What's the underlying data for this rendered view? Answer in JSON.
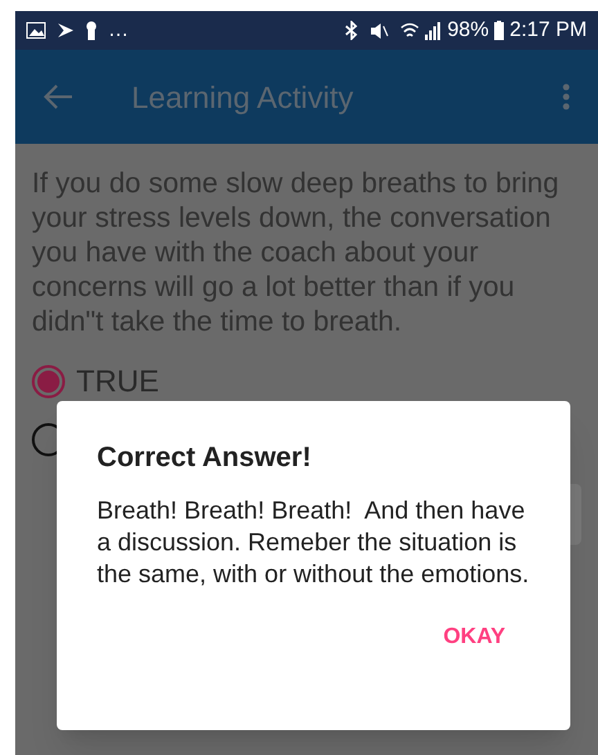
{
  "status_bar": {
    "overflow": "…",
    "battery": "98%",
    "time": "2:17 PM"
  },
  "app_bar": {
    "title": "Learning Activity"
  },
  "question": "If you do some slow deep breaths to bring your stress levels down, the conversation you have with the coach about your concerns will go a lot better than if you didn\"t take the time to breath.",
  "options": [
    {
      "label": "TRUE",
      "selected": true
    },
    {
      "selected": false
    }
  ],
  "dialog": {
    "title": "Correct Answer!",
    "message": "Breath! Breath! Breath!  And then have a discussion. Remeber the situation is the same, with or without the emotions.",
    "button": "OKAY"
  }
}
